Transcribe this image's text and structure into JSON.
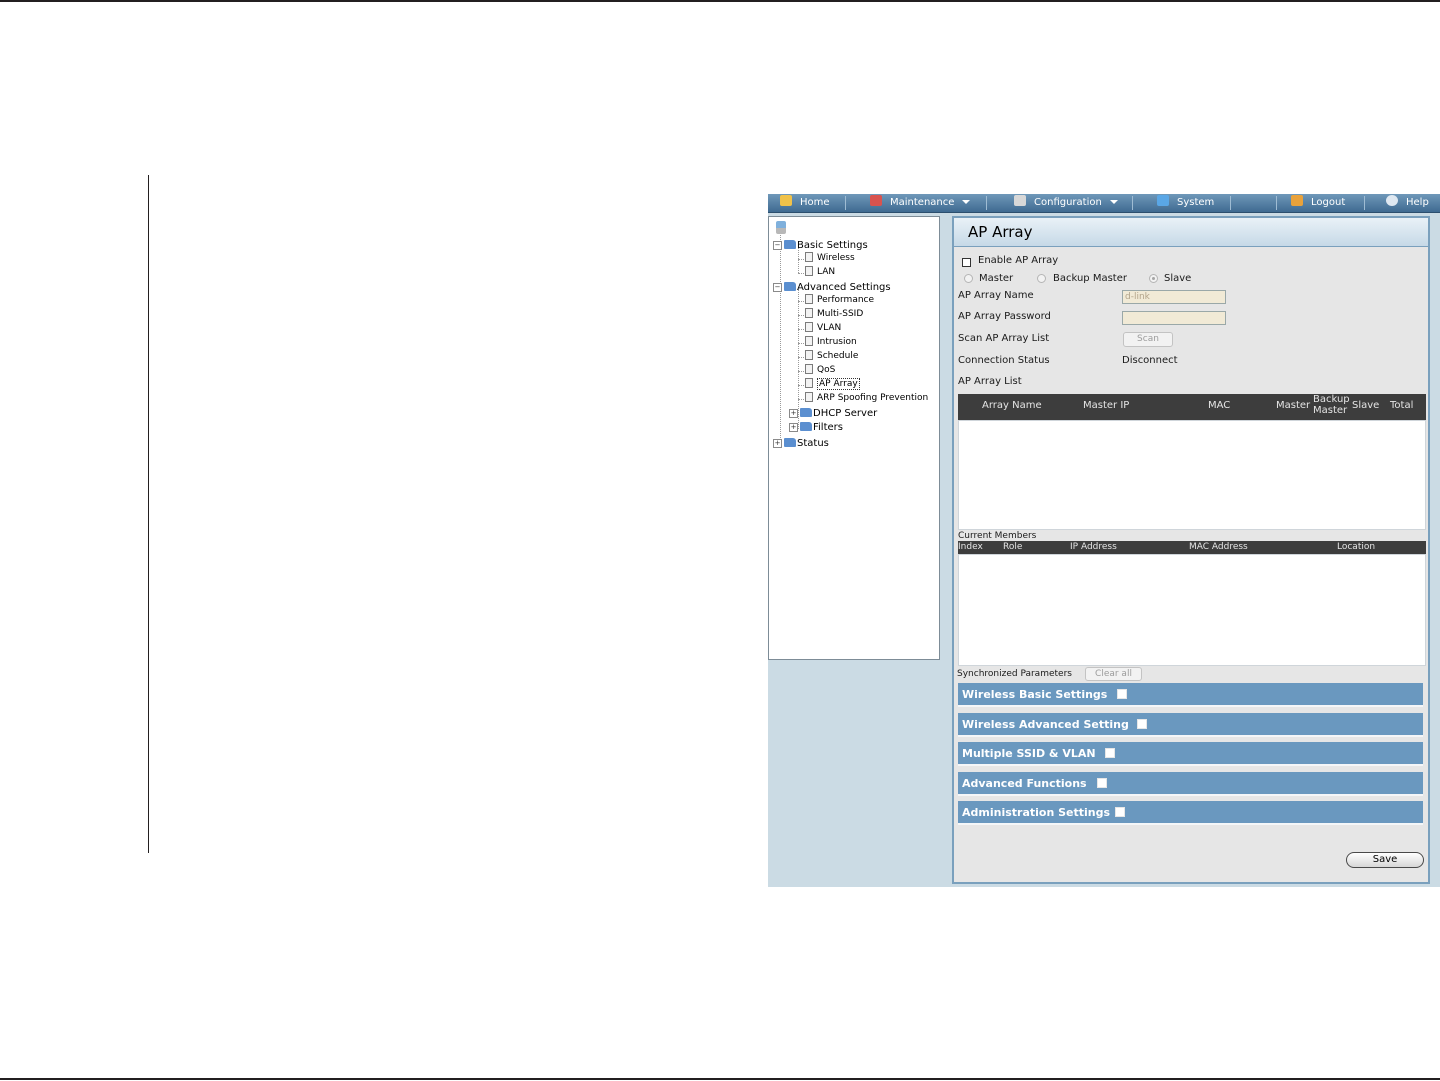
{
  "menu": {
    "home": "Home",
    "maintenance": "Maintenance",
    "configuration": "Configuration",
    "system": "System",
    "logout": "Logout",
    "help": "Help"
  },
  "tree": {
    "basic_settings": "Basic Settings",
    "wireless": "Wireless",
    "lan": "LAN",
    "advanced_settings": "Advanced Settings",
    "performance": "Performance",
    "multi_ssid": "Multi-SSID",
    "vlan": "VLAN",
    "intrusion": "Intrusion",
    "schedule": "Schedule",
    "qos": "QoS",
    "ap_array": "AP Array",
    "arp_spoofing": "ARP Spoofing Prevention",
    "dhcp_server": "DHCP Server",
    "filters": "Filters",
    "status": "Status"
  },
  "panel": {
    "title": "AP Array",
    "enable_label": "Enable AP Array",
    "roles": {
      "master": "Master",
      "backup_master": "Backup Master",
      "slave": "Slave"
    },
    "name_label": "AP Array Name",
    "name_value": "d-link",
    "password_label": "AP Array Password",
    "password_value": "",
    "scan_label": "Scan AP Array List",
    "scan_button": "Scan",
    "status_label": "Connection Status",
    "status_value": "Disconnect",
    "list_label": "AP Array List",
    "list_columns": {
      "array_name": "Array Name",
      "master_ip": "Master IP",
      "mac": "MAC",
      "master": "Master",
      "backup_master_1": "Backup",
      "backup_master_2": "Master",
      "slave": "Slave",
      "total": "Total"
    },
    "members_label": "Current Members",
    "members_columns": {
      "index": "Index",
      "role": "Role",
      "ip_address": "IP Address",
      "mac_address": "MAC Address",
      "location": "Location"
    },
    "sync_label": "Synchronized Parameters",
    "clear_all": "Clear all",
    "sync_sections": [
      "Wireless Basic Settings",
      "Wireless Advanced Setting",
      "Multiple SSID & VLAN",
      "Advanced Functions",
      "Administration Settings"
    ],
    "save": "Save"
  },
  "colors": {
    "menubar": "#4a77a0",
    "sync_bar": "#6a98bf",
    "table_header": "#3d3d3d",
    "panel_bg": "#cbdbe4"
  }
}
